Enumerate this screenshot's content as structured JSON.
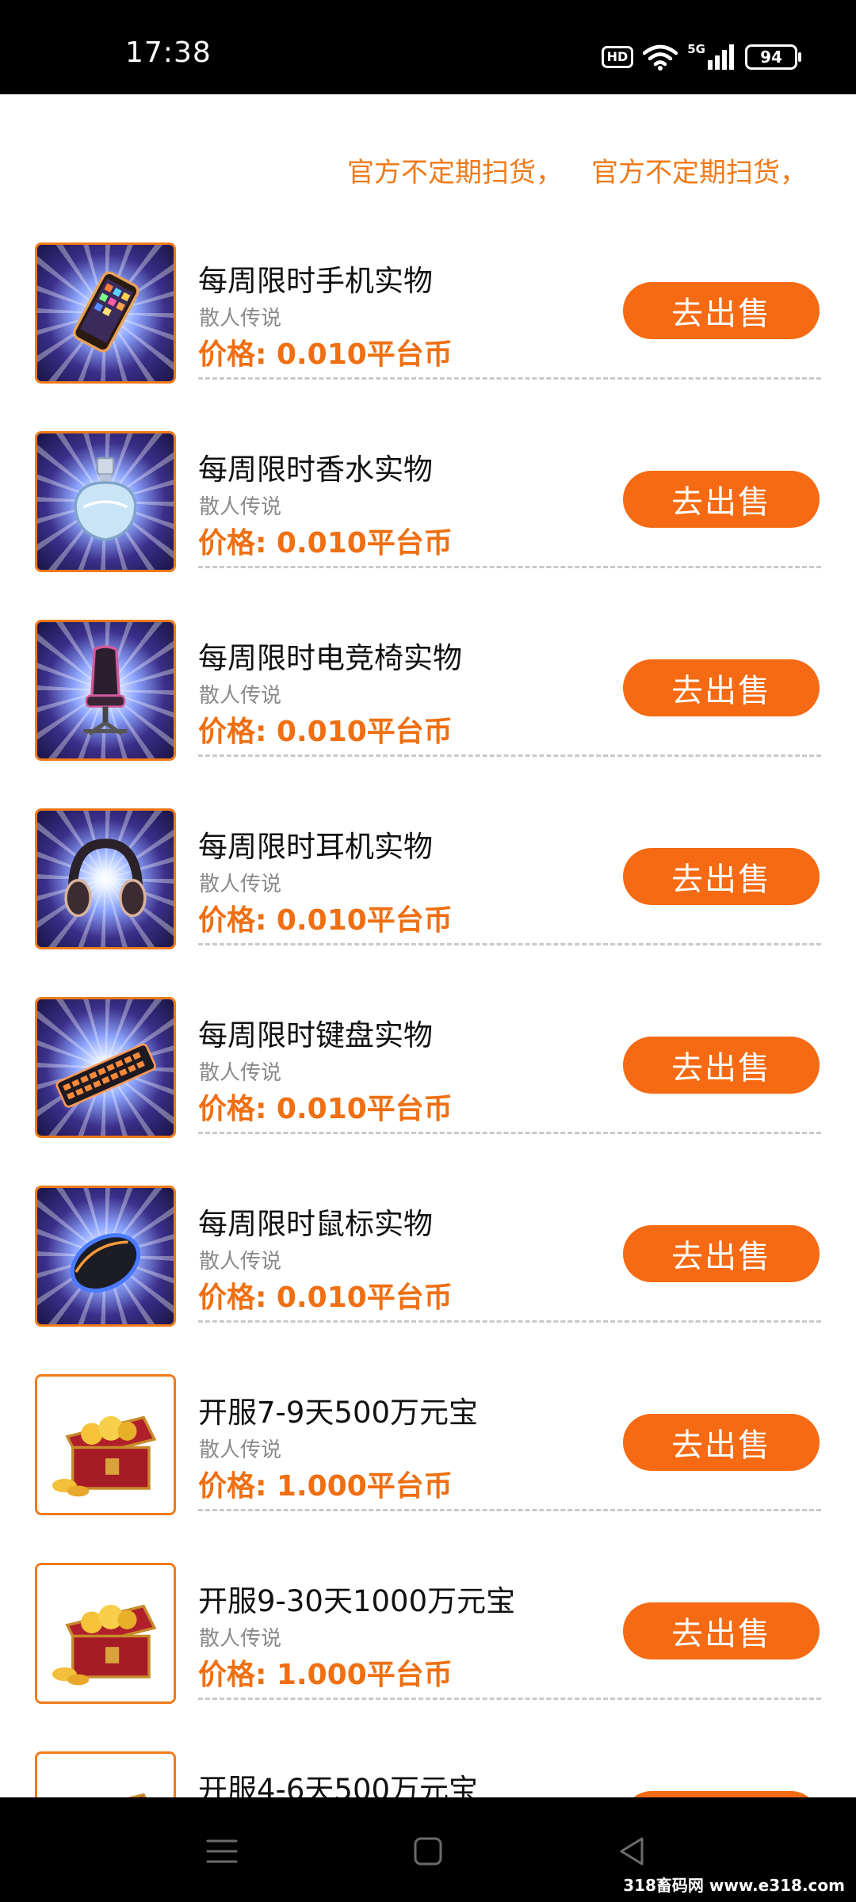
{
  "status_bar": {
    "time": "17:38",
    "hd": "HD",
    "network": "5G",
    "battery": "94"
  },
  "marquee": {
    "items": [
      "官方不定期扫货，",
      "官方不定期扫货，"
    ]
  },
  "items": [
    {
      "title": "每周限时手机实物",
      "subtitle": "散人传说",
      "price": "价格: 0.010平台币",
      "button": "去出售",
      "image": "phone-image"
    },
    {
      "title": "每周限时香水实物",
      "subtitle": "散人传说",
      "price": "价格: 0.010平台币",
      "button": "去出售",
      "image": "perfume-image"
    },
    {
      "title": "每周限时电竞椅实物",
      "subtitle": "散人传说",
      "price": "价格: 0.010平台币",
      "button": "去出售",
      "image": "gaming-chair-image"
    },
    {
      "title": "每周限时耳机实物",
      "subtitle": "散人传说",
      "price": "价格: 0.010平台币",
      "button": "去出售",
      "image": "headphones-image"
    },
    {
      "title": "每周限时键盘实物",
      "subtitle": "散人传说",
      "price": "价格: 0.010平台币",
      "button": "去出售",
      "image": "keyboard-image"
    },
    {
      "title": "每周限时鼠标实物",
      "subtitle": "散人传说",
      "price": "价格: 0.010平台币",
      "button": "去出售",
      "image": "mouse-image"
    },
    {
      "title": "开服7-9天500万元宝",
      "subtitle": "散人传说",
      "price": "价格: 1.000平台币",
      "button": "去出售",
      "image": "treasure-chest-image"
    },
    {
      "title": "开服9-30天1000万元宝",
      "subtitle": "散人传说",
      "price": "价格: 1.000平台币",
      "button": "去出售",
      "image": "treasure-chest-image"
    },
    {
      "title": "开服4-6天500万元宝",
      "subtitle": "",
      "price": "",
      "button": "",
      "image": "treasure-chest-image"
    }
  ],
  "watermark": "318畜码网 www.e318.com",
  "colors": {
    "accent": "#f56a12",
    "price": "#ef6f12",
    "marquee": "#f07a1a"
  }
}
